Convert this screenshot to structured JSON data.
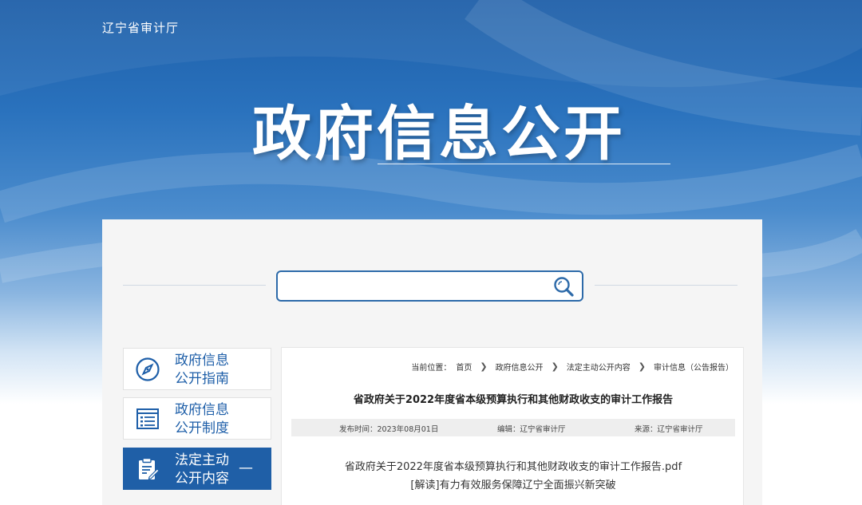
{
  "site": {
    "org_name": "辽宁省审计厅",
    "hero_title": "政府信息公开"
  },
  "search": {
    "value": "",
    "placeholder": ""
  },
  "sidebar": {
    "items": [
      {
        "label_line1": "政府信息",
        "label_line2": "公开指南",
        "icon": "compass-icon",
        "active": false
      },
      {
        "label_line1": "政府信息",
        "label_line2": "公开制度",
        "icon": "list-icon",
        "active": false
      },
      {
        "label_line1": "法定主动",
        "label_line2": "公开内容",
        "icon": "clipboard-edit-icon",
        "active": true,
        "expand_symbol": "—"
      }
    ]
  },
  "breadcrumb": {
    "prefix": "当前位置：",
    "items": [
      "首页",
      "政府信息公开",
      "法定主动公开内容",
      "审计信息（公告报告）"
    ]
  },
  "article": {
    "title": "省政府关于2022年度省本级预算执行和其他财政收支的审计工作报告",
    "publish_time": "发布时间：2023年08月01日",
    "editor": "编辑：辽宁省审计厅",
    "source": "来源：辽宁省审计厅",
    "attachments": [
      "省政府关于2022年度省本级预算执行和其他财政收支的审计工作报告.pdf",
      "[解读]有力有效服务保障辽宁全面振兴新突破"
    ]
  },
  "colors": {
    "primary": "#1f5fa7",
    "accent_blue": "#2d6aa9"
  }
}
